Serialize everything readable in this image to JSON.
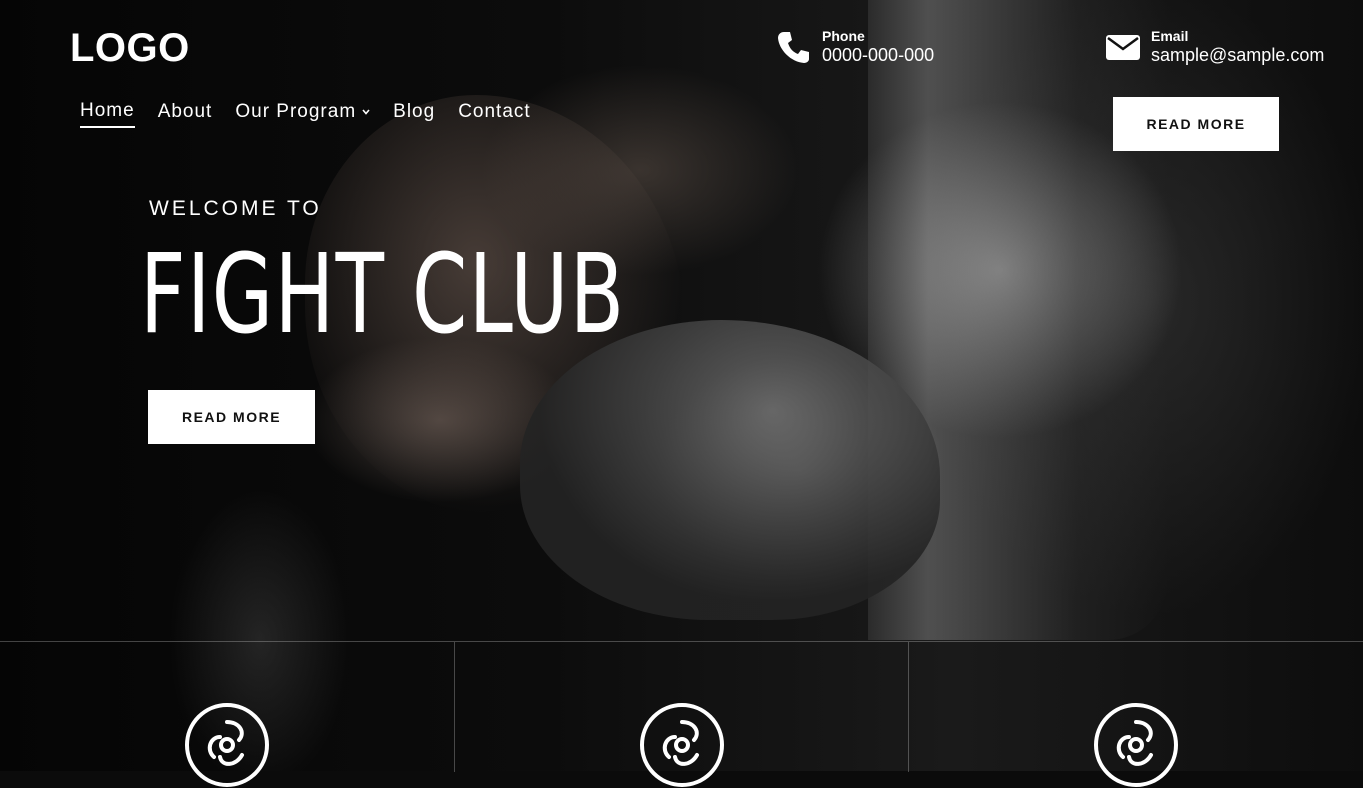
{
  "header": {
    "logo": "LOGO",
    "phone": {
      "label": "Phone",
      "value": "0000-000-000",
      "icon": "phone-icon"
    },
    "email": {
      "label": "Email",
      "value": "sample@sample.com",
      "icon": "envelope-icon"
    },
    "cta_label": "READ MORE"
  },
  "nav": {
    "items": [
      {
        "label": "Home",
        "active": true
      },
      {
        "label": "About"
      },
      {
        "label": "Our Program",
        "has_dropdown": true
      },
      {
        "label": "Blog"
      },
      {
        "label": "Contact"
      }
    ]
  },
  "hero": {
    "kicker": "WELCOME TO",
    "title": "FIGHT CLUB",
    "button_label": "READ MORE"
  },
  "features": [
    {
      "icon": "triskelion-emblem-icon"
    },
    {
      "icon": "triskelion-emblem-icon"
    },
    {
      "icon": "triskelion-emblem-icon"
    }
  ]
}
